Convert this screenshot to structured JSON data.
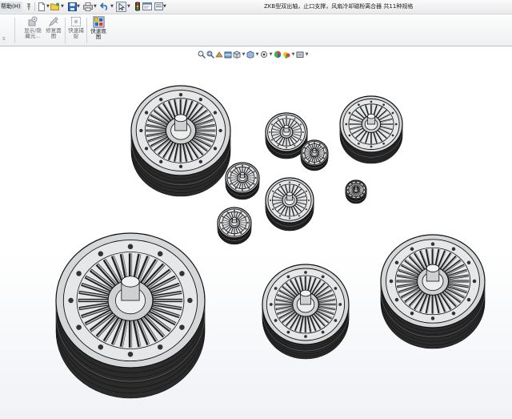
{
  "menu": {
    "help": "帮助(H)"
  },
  "window": {
    "title": "ZKB型双出轴，止口支撑，风扇冷却磁粉离合器 共11种规格"
  },
  "colors": {
    "accent": "#2b6fb8",
    "part_fill": "#d6d7d9",
    "part_edge": "#111111"
  },
  "quick_access": {
    "icons": [
      "pin-icon",
      "new-document-icon",
      "open-folder-icon",
      "save-icon",
      "print-icon",
      "undo-icon",
      "select-icon",
      "rebuild-icon",
      "file-properties-icon"
    ]
  },
  "ribbon": {
    "buttons": [
      {
        "id": "show-hide-components",
        "label": "显示/隐\n藏元..."
      },
      {
        "id": "edit-component",
        "label": "修复面\n图"
      },
      {
        "id": "quick-capture",
        "label": "快速捕\n捉"
      },
      {
        "id": "quick-view",
        "label": "快速观\n图"
      }
    ]
  },
  "view_toolbar": {
    "icons": [
      "zoom-to-fit-icon",
      "zoom-area-icon",
      "previous-view-icon",
      "section-view-icon",
      "view-orientation-icon",
      "display-style-icon",
      "hide-show-items-icon",
      "edit-appearance-icon",
      "apply-scene-icon",
      "view-settings-icon"
    ]
  }
}
